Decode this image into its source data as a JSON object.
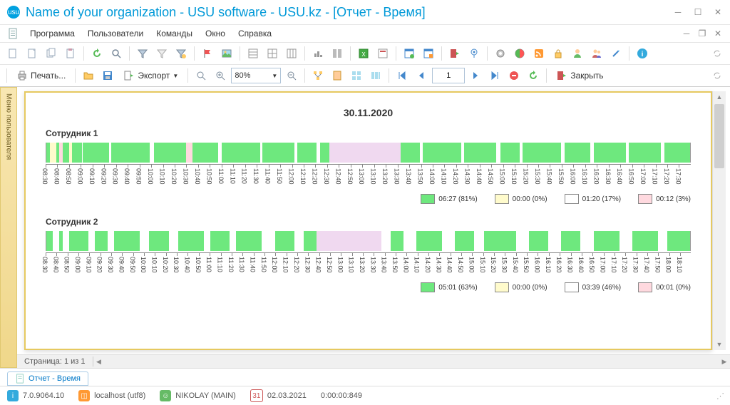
{
  "title": "Name of your organization - USU software - USU.kz - [Отчет - Время]",
  "menu": {
    "program": "Программа",
    "users": "Пользователи",
    "commands": "Команды",
    "window": "Окно",
    "help": "Справка"
  },
  "toolbar2": {
    "print": "Печать...",
    "export": "Экспорт",
    "zoom": "80%",
    "page": "1",
    "close": "Закрыть"
  },
  "side_tab": "Меню пользователя",
  "page_indicator": "Страница: 1 из 1",
  "bottom_tab": "Отчет - Время",
  "status": {
    "version": "7.0.9064.10",
    "host": "localhost (utf8)",
    "user": "NIKOLAY (MAIN)",
    "date": "02.03.2021",
    "time": "0:00:00:849"
  },
  "chart_data": {
    "type": "bar",
    "date": "30.11.2020",
    "colors": {
      "active": "#6ee87e",
      "neutral": "#f0d9f0",
      "warn1": "#fffbcc",
      "warn2": "#ffffff",
      "warn3": "#ffd9df"
    },
    "employees": [
      {
        "name": "Сотрудник 1",
        "start": "08:30",
        "end": "17:30",
        "segments": [
          {
            "t": 0.0,
            "w": 0.005,
            "c": "active"
          },
          {
            "t": 0.005,
            "w": 0.01,
            "c": "warn1"
          },
          {
            "t": 0.015,
            "w": 0.005,
            "c": "active"
          },
          {
            "t": 0.02,
            "w": 0.005,
            "c": "warn3"
          },
          {
            "t": 0.025,
            "w": 0.01,
            "c": "active"
          },
          {
            "t": 0.035,
            "w": 0.005,
            "c": "warn1"
          },
          {
            "t": 0.04,
            "w": 0.015,
            "c": "active"
          },
          {
            "t": 0.055,
            "w": 0.002,
            "c": "warn2"
          },
          {
            "t": 0.057,
            "w": 0.04,
            "c": "active"
          },
          {
            "t": 0.097,
            "w": 0.004,
            "c": "warn2"
          },
          {
            "t": 0.101,
            "w": 0.06,
            "c": "active"
          },
          {
            "t": 0.161,
            "w": 0.006,
            "c": "warn2"
          },
          {
            "t": 0.167,
            "w": 0.05,
            "c": "active"
          },
          {
            "t": 0.217,
            "w": 0.01,
            "c": "warn3"
          },
          {
            "t": 0.227,
            "w": 0.04,
            "c": "active"
          },
          {
            "t": 0.267,
            "w": 0.005,
            "c": "warn2"
          },
          {
            "t": 0.272,
            "w": 0.06,
            "c": "active"
          },
          {
            "t": 0.332,
            "w": 0.003,
            "c": "warn2"
          },
          {
            "t": 0.335,
            "w": 0.05,
            "c": "active"
          },
          {
            "t": 0.385,
            "w": 0.005,
            "c": "warn2"
          },
          {
            "t": 0.39,
            "w": 0.03,
            "c": "active"
          },
          {
            "t": 0.42,
            "w": 0.005,
            "c": "warn2"
          },
          {
            "t": 0.425,
            "w": 0.015,
            "c": "active"
          },
          {
            "t": 0.44,
            "w": 0.11,
            "c": "neutral"
          },
          {
            "t": 0.55,
            "w": 0.03,
            "c": "active"
          },
          {
            "t": 0.58,
            "w": 0.005,
            "c": "warn2"
          },
          {
            "t": 0.585,
            "w": 0.06,
            "c": "active"
          },
          {
            "t": 0.645,
            "w": 0.004,
            "c": "warn2"
          },
          {
            "t": 0.649,
            "w": 0.05,
            "c": "active"
          },
          {
            "t": 0.699,
            "w": 0.006,
            "c": "warn2"
          },
          {
            "t": 0.705,
            "w": 0.03,
            "c": "active"
          },
          {
            "t": 0.735,
            "w": 0.005,
            "c": "warn2"
          },
          {
            "t": 0.74,
            "w": 0.06,
            "c": "active"
          },
          {
            "t": 0.8,
            "w": 0.005,
            "c": "warn2"
          },
          {
            "t": 0.805,
            "w": 0.04,
            "c": "active"
          },
          {
            "t": 0.845,
            "w": 0.005,
            "c": "warn2"
          },
          {
            "t": 0.85,
            "w": 0.05,
            "c": "active"
          },
          {
            "t": 0.9,
            "w": 0.005,
            "c": "warn2"
          },
          {
            "t": 0.905,
            "w": 0.05,
            "c": "active"
          },
          {
            "t": 0.955,
            "w": 0.005,
            "c": "warn2"
          },
          {
            "t": 0.96,
            "w": 0.04,
            "c": "active"
          }
        ],
        "ticks": [
          "08:30",
          "08:40",
          "08:50",
          "09:00",
          "09:10",
          "09:20",
          "09:30",
          "09:40",
          "09:50",
          "10:00",
          "10:10",
          "10:20",
          "10:30",
          "10:40",
          "10:50",
          "11:00",
          "11:10",
          "11:20",
          "11:30",
          "11:40",
          "11:50",
          "12:00",
          "12:10",
          "12:20",
          "12:30",
          "12:40",
          "12:50",
          "13:00",
          "13:10",
          "13:20",
          "13:30",
          "13:40",
          "13:50",
          "14:00",
          "14:10",
          "14:20",
          "14:30",
          "14:40",
          "14:50",
          "15:00",
          "15:10",
          "15:20",
          "15:30",
          "15:40",
          "15:50",
          "16:00",
          "16:10",
          "16:20",
          "16:30",
          "16:40",
          "16:50",
          "17:00",
          "17:10",
          "17:20",
          "17:30"
        ],
        "legend": [
          {
            "color": "active",
            "label": "06:27 (81%)"
          },
          {
            "color": "warn1",
            "label": "00:00 (0%)"
          },
          {
            "color": "warn2",
            "label": "01:20 (17%)"
          },
          {
            "color": "warn3",
            "label": "00:12 (3%)"
          }
        ]
      },
      {
        "name": "Сотрудник 2",
        "start": "08:30",
        "end": "18:10",
        "segments": [
          {
            "t": 0.0,
            "w": 0.01,
            "c": "active"
          },
          {
            "t": 0.01,
            "w": 0.01,
            "c": "warn2"
          },
          {
            "t": 0.02,
            "w": 0.005,
            "c": "active"
          },
          {
            "t": 0.025,
            "w": 0.01,
            "c": "warn2"
          },
          {
            "t": 0.035,
            "w": 0.03,
            "c": "active"
          },
          {
            "t": 0.065,
            "w": 0.01,
            "c": "warn2"
          },
          {
            "t": 0.075,
            "w": 0.02,
            "c": "active"
          },
          {
            "t": 0.095,
            "w": 0.01,
            "c": "warn2"
          },
          {
            "t": 0.105,
            "w": 0.04,
            "c": "active"
          },
          {
            "t": 0.145,
            "w": 0.015,
            "c": "warn2"
          },
          {
            "t": 0.16,
            "w": 0.03,
            "c": "active"
          },
          {
            "t": 0.19,
            "w": 0.015,
            "c": "warn2"
          },
          {
            "t": 0.205,
            "w": 0.04,
            "c": "active"
          },
          {
            "t": 0.245,
            "w": 0.01,
            "c": "warn2"
          },
          {
            "t": 0.255,
            "w": 0.03,
            "c": "active"
          },
          {
            "t": 0.285,
            "w": 0.01,
            "c": "warn2"
          },
          {
            "t": 0.295,
            "w": 0.04,
            "c": "active"
          },
          {
            "t": 0.335,
            "w": 0.02,
            "c": "warn2"
          },
          {
            "t": 0.355,
            "w": 0.03,
            "c": "active"
          },
          {
            "t": 0.385,
            "w": 0.015,
            "c": "warn2"
          },
          {
            "t": 0.4,
            "w": 0.02,
            "c": "active"
          },
          {
            "t": 0.42,
            "w": 0.1,
            "c": "neutral"
          },
          {
            "t": 0.52,
            "w": 0.015,
            "c": "warn2"
          },
          {
            "t": 0.535,
            "w": 0.02,
            "c": "active"
          },
          {
            "t": 0.555,
            "w": 0.02,
            "c": "warn2"
          },
          {
            "t": 0.575,
            "w": 0.04,
            "c": "active"
          },
          {
            "t": 0.615,
            "w": 0.02,
            "c": "warn2"
          },
          {
            "t": 0.635,
            "w": 0.03,
            "c": "active"
          },
          {
            "t": 0.665,
            "w": 0.015,
            "c": "warn2"
          },
          {
            "t": 0.68,
            "w": 0.05,
            "c": "active"
          },
          {
            "t": 0.73,
            "w": 0.02,
            "c": "warn2"
          },
          {
            "t": 0.75,
            "w": 0.03,
            "c": "active"
          },
          {
            "t": 0.78,
            "w": 0.02,
            "c": "warn2"
          },
          {
            "t": 0.8,
            "w": 0.03,
            "c": "active"
          },
          {
            "t": 0.83,
            "w": 0.02,
            "c": "warn2"
          },
          {
            "t": 0.85,
            "w": 0.04,
            "c": "active"
          },
          {
            "t": 0.89,
            "w": 0.02,
            "c": "warn2"
          },
          {
            "t": 0.91,
            "w": 0.04,
            "c": "active"
          },
          {
            "t": 0.95,
            "w": 0.015,
            "c": "warn2"
          },
          {
            "t": 0.965,
            "w": 0.035,
            "c": "active"
          }
        ],
        "ticks": [
          "08:30",
          "08:40",
          "08:50",
          "09:00",
          "09:10",
          "09:20",
          "09:30",
          "09:40",
          "09:50",
          "10:00",
          "10:10",
          "10:20",
          "10:30",
          "10:40",
          "10:50",
          "11:00",
          "11:10",
          "11:20",
          "11:30",
          "11:40",
          "11:50",
          "12:00",
          "12:10",
          "12:20",
          "12:30",
          "12:40",
          "12:50",
          "13:00",
          "13:10",
          "13:20",
          "13:30",
          "13:40",
          "13:50",
          "14:00",
          "14:10",
          "14:20",
          "14:30",
          "14:40",
          "14:50",
          "15:00",
          "15:10",
          "15:20",
          "15:30",
          "15:40",
          "15:50",
          "16:00",
          "16:10",
          "16:20",
          "16:30",
          "16:40",
          "16:50",
          "17:00",
          "17:10",
          "17:20",
          "17:30",
          "17:40",
          "17:50",
          "18:00",
          "18:10"
        ],
        "legend": [
          {
            "color": "active",
            "label": "05:01 (63%)"
          },
          {
            "color": "warn1",
            "label": "00:00 (0%)"
          },
          {
            "color": "warn2",
            "label": "03:39 (46%)"
          },
          {
            "color": "warn3",
            "label": "00:01 (0%)"
          }
        ]
      }
    ]
  }
}
